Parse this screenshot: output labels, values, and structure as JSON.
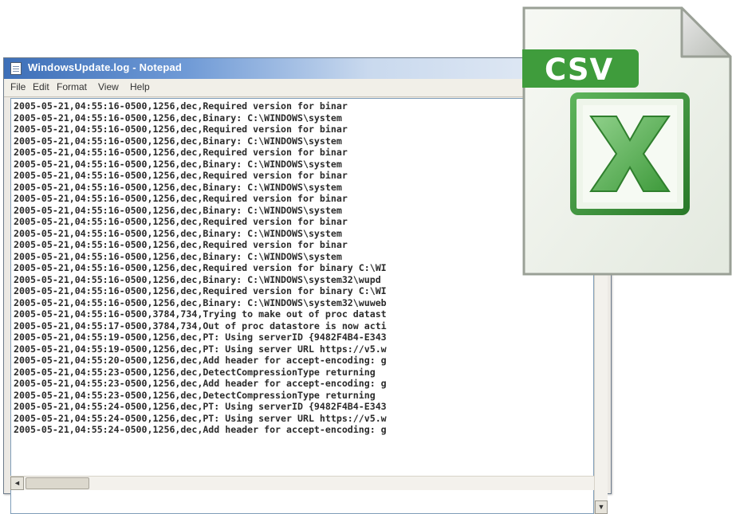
{
  "window": {
    "title": "WindowsUpdate.log - Notepad"
  },
  "menu": {
    "items": [
      "File",
      "Edit",
      "Format",
      "View",
      "Help"
    ]
  },
  "log_lines": [
    "2005-05-21,04:55:16-0500,1256,dec,Required version for binar",
    "2005-05-21,04:55:16-0500,1256,dec,Binary: C:\\WINDOWS\\system",
    "2005-05-21,04:55:16-0500,1256,dec,Required version for binar",
    "2005-05-21,04:55:16-0500,1256,dec,Binary: C:\\WINDOWS\\system",
    "2005-05-21,04:55:16-0500,1256,dec,Required version for binar",
    "2005-05-21,04:55:16-0500,1256,dec,Binary: C:\\WINDOWS\\system",
    "2005-05-21,04:55:16-0500,1256,dec,Required version for binar",
    "2005-05-21,04:55:16-0500,1256,dec,Binary: C:\\WINDOWS\\system",
    "2005-05-21,04:55:16-0500,1256,dec,Required version for binar",
    "2005-05-21,04:55:16-0500,1256,dec,Binary: C:\\WINDOWS\\system",
    "2005-05-21,04:55:16-0500,1256,dec,Required version for binar",
    "2005-05-21,04:55:16-0500,1256,dec,Binary: C:\\WINDOWS\\system",
    "2005-05-21,04:55:16-0500,1256,dec,Required version for binar",
    "2005-05-21,04:55:16-0500,1256,dec,Binary: C:\\WINDOWS\\system",
    "2005-05-21,04:55:16-0500,1256,dec,Required version for binary C:\\WI",
    "2005-05-21,04:55:16-0500,1256,dec,Binary: C:\\WINDOWS\\system32\\wupd",
    "2005-05-21,04:55:16-0500,1256,dec,Required version for binary C:\\WI",
    "2005-05-21,04:55:16-0500,1256,dec,Binary: C:\\WINDOWS\\system32\\wuweb",
    "2005-05-21,04:55:16-0500,3784,734,Trying to make out of proc datast",
    "2005-05-21,04:55:17-0500,3784,734,Out of proc datastore is now acti",
    "2005-05-21,04:55:19-0500,1256,dec,PT: Using serverID {9482F4B4-E343",
    "2005-05-21,04:55:19-0500,1256,dec,PT: Using server URL https://v5.w",
    "2005-05-21,04:55:20-0500,1256,dec,Add header for accept-encoding: g",
    "2005-05-21,04:55:23-0500,1256,dec,DetectCompressionType returning",
    "2005-05-21,04:55:23-0500,1256,dec,Add header for accept-encoding: g",
    "2005-05-21,04:55:23-0500,1256,dec,DetectCompressionType returning",
    "2005-05-21,04:55:24-0500,1256,dec,PT: Using serverID {9482F4B4-E343",
    "2005-05-21,04:55:24-0500,1256,dec,PT: Using server URL https://v5.w",
    "2005-05-21,04:55:24-0500,1256,dec,Add header for accept-encoding: g"
  ],
  "scrollbar": {
    "down_arrow": "▼",
    "left_arrow": "◄"
  },
  "file_icon": {
    "label": "CSV",
    "app_icon": "excel-icon",
    "colors": {
      "label_green": "#3f9c3c",
      "logo_green": "#2e8b2e",
      "page_bg": "#f2f6ee"
    }
  }
}
